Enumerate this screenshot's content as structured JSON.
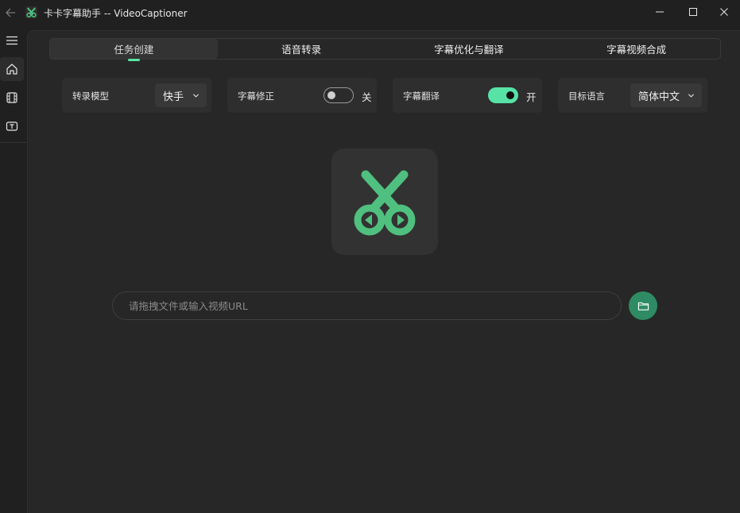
{
  "window": {
    "title": "卡卡字幕助手 -- VideoCaptioner"
  },
  "tabs": [
    {
      "label": "任务创建",
      "active": true
    },
    {
      "label": "语音转录",
      "active": false
    },
    {
      "label": "字幕优化与翻译",
      "active": false
    },
    {
      "label": "字幕视频合成",
      "active": false
    }
  ],
  "settings": {
    "transcribe_model": {
      "label": "转录模型",
      "value": "快手"
    },
    "subtitle_fix": {
      "label": "字幕修正",
      "state": "关",
      "on": false
    },
    "subtitle_translate": {
      "label": "字幕翻译",
      "state": "开",
      "on": true
    },
    "target_language": {
      "label": "目标语言",
      "value": "简体中文"
    }
  },
  "input": {
    "placeholder": "请拖拽文件或输入视频URL",
    "value": ""
  },
  "icons": {
    "back": "arrow-left-icon",
    "app": "scissors-icon",
    "menu": "hamburger-icon",
    "home": "home-icon",
    "film": "film-icon",
    "subtitle": "subtitle-icon",
    "logo": "scissors-play-icon",
    "folder": "folder-icon"
  },
  "colors": {
    "accent": "#55e6a4",
    "logo_green": "#4fc07f",
    "button_green": "#2e8b64",
    "background": "#272727"
  }
}
